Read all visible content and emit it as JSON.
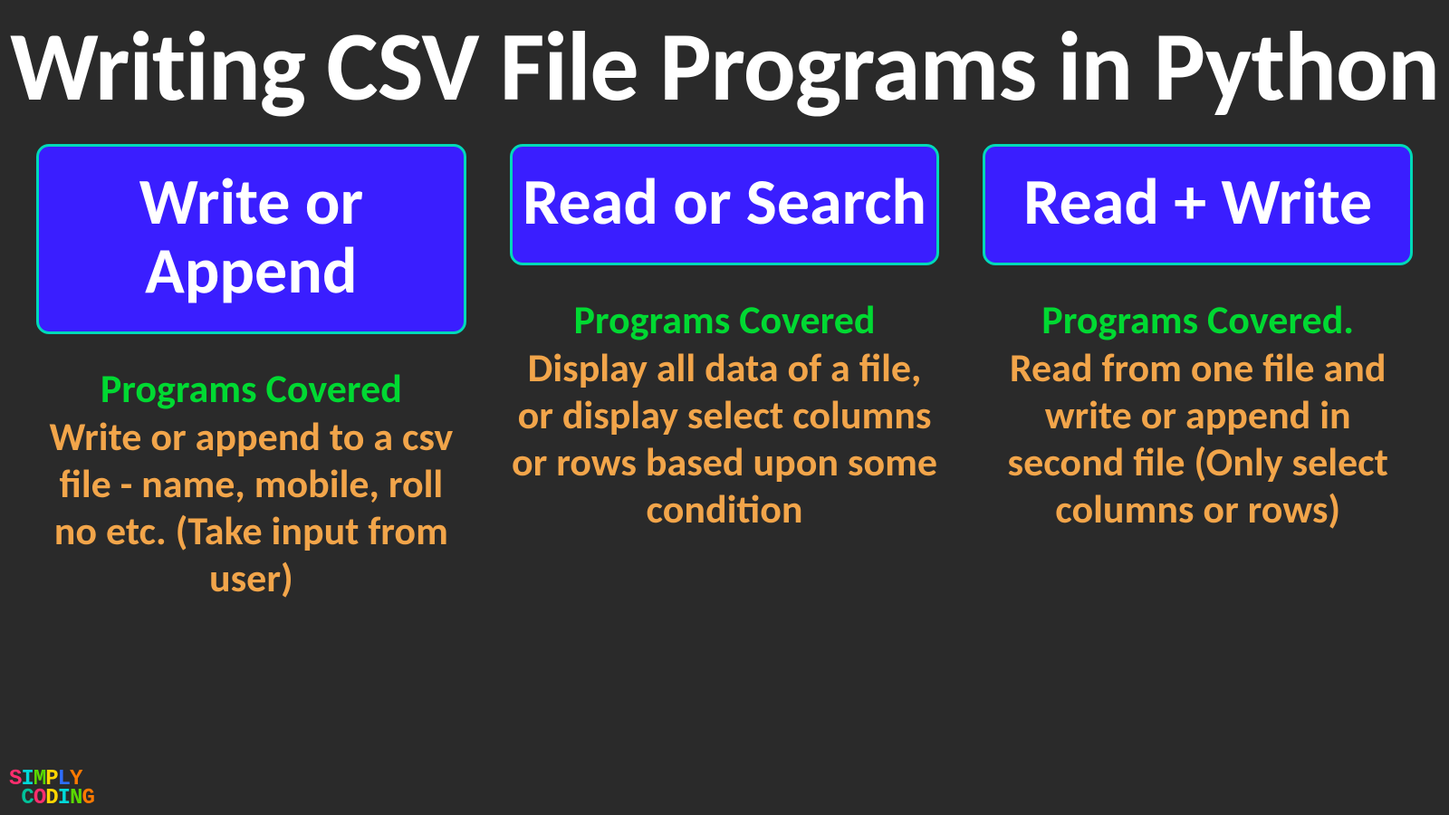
{
  "title": "Writing CSV File Programs in Python",
  "columns": [
    {
      "card": "Write or Append",
      "subhead": "Programs Covered",
      "desc": "Write or append to a csv file  - name, mobile, roll no etc. (Take input from user)"
    },
    {
      "card": "Read or Search",
      "subhead": "Programs Covered",
      "desc": "Display all data of a file, or display select columns or rows based upon some condition"
    },
    {
      "card": "Read + Write",
      "subhead": "Programs Covered.",
      "desc": "Read from one file and write or append in second file (Only select columns or rows)"
    }
  ],
  "logo_line1": "SIMPLY",
  "logo_line2": "CODING"
}
